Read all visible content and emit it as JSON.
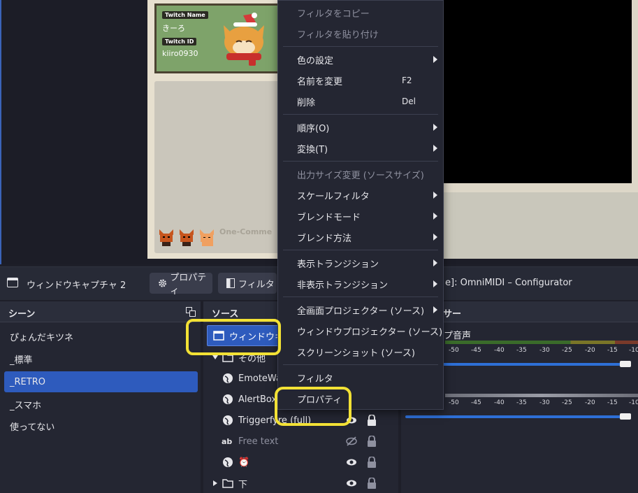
{
  "preview": {
    "profile_card": {
      "name_tag": "Twitch Name",
      "name_value": "きーろ",
      "id_tag": "Twitch ID",
      "id_value": "kiiro0930"
    },
    "chat_brand": "One-Comme"
  },
  "toolbar": {
    "source_name": "ウィンドウキャプチャ 2",
    "properties_label": "プロパティ",
    "filters_label": "フィルタ",
    "window_title": "e]: OmniMIDI – Configurator"
  },
  "scenes": {
    "title": "シーン",
    "items": [
      {
        "label": "ぴょんだキツネ",
        "active": false
      },
      {
        "label": "_標準",
        "active": false
      },
      {
        "label": "_RETRO",
        "active": true
      },
      {
        "label": "_スマホ",
        "active": false
      },
      {
        "label": "使ってない",
        "active": false
      }
    ]
  },
  "sources": {
    "title": "ソース",
    "items": [
      {
        "label": "ウィンドウキャ",
        "icon": "window-icon"
      },
      {
        "label": "その他",
        "icon": "folder-icon"
      },
      {
        "label": "EmoteWa",
        "icon": "globe-icon"
      },
      {
        "label": "AlertBox",
        "icon": "globe-icon"
      },
      {
        "label": "Triggerfyre (full)",
        "icon": "globe-icon"
      },
      {
        "label": "Free text",
        "icon": "text-icon"
      },
      {
        "label": "⏰",
        "icon": "globe-icon"
      },
      {
        "label": "下",
        "icon": "folder-icon"
      }
    ]
  },
  "mixer": {
    "title": "サー",
    "channel1": "プ音声",
    "ticks": [
      "-50",
      "-45",
      "-40",
      "-35",
      "-30",
      "-25",
      "-20",
      "-15",
      "-10"
    ]
  },
  "context_menu": {
    "copy_filters": "フィルタをコピー",
    "paste_filters": "フィルタを貼り付け",
    "color": "色の設定",
    "rename": "名前を変更",
    "rename_sc": "F2",
    "delete": "削除",
    "delete_sc": "Del",
    "order": "順序(O)",
    "transform": "変換(T)",
    "resize_output": "出力サイズ変更 (ソースサイズ)",
    "scale_filter": "スケールフィルタ",
    "blend_mode": "ブレンドモード",
    "blend_method": "ブレンド方法",
    "show_transition": "表示トランジション",
    "hide_transition": "非表示トランジション",
    "fullscreen_projector": "全画面プロジェクター (ソース)",
    "window_projector": "ウィンドウプロジェクター (ソース)",
    "screenshot": "スクリーンショット (ソース)",
    "filters": "フィルタ",
    "properties": "プロパティ"
  },
  "colors": {
    "accent": "#2e5bbd",
    "highlight": "#f2e135",
    "background": "#1e1f29"
  }
}
